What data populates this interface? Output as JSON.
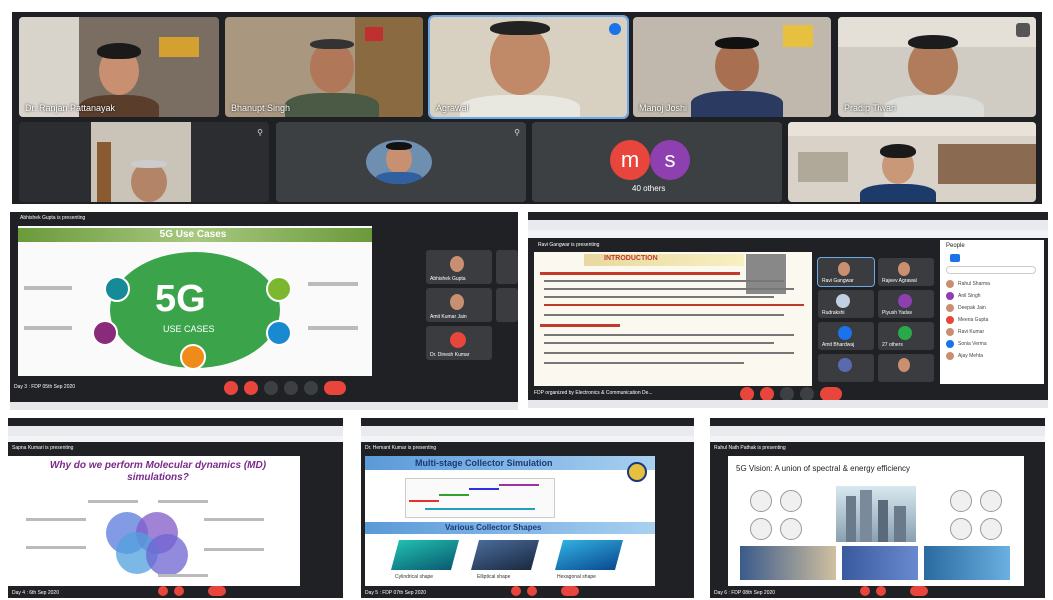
{
  "meeting": {
    "participants": [
      {
        "name": "Dr. Ranjan Pattanayak"
      },
      {
        "name": "Bhanupt Singh"
      },
      {
        "name": "Agrawal"
      },
      {
        "name": "Manoj Joshi"
      },
      {
        "name": "Pradip Tiwari"
      }
    ],
    "others_label": "40 others",
    "avatar_m": "m",
    "avatar_s": "s"
  },
  "ss1": {
    "presenting": "Abhishek Gupta is presenting",
    "slide_title": "5G Use Cases",
    "center_big": "5G",
    "center_small": "USE CASES",
    "side": [
      {
        "name": "Abhishek Gupta"
      },
      {
        "name": "Amit Kumar Jain"
      },
      {
        "name": "Dr. Dinesh Kumar"
      }
    ],
    "footer": "Day 3 : FDP 05th Sep 2020"
  },
  "ss2": {
    "presenting": "Ravi Gangwar is presenting",
    "slide_title": "INTRODUCTION",
    "people_title": "People",
    "side": [
      {
        "name": "Ravi Gangwar"
      },
      {
        "name": "Rajeev Agrawal"
      },
      {
        "name": "Rudrakshi"
      },
      {
        "name": "Piyush Yadav"
      },
      {
        "name": "Amit Bhardwaj"
      },
      {
        "name": "27 others"
      }
    ],
    "people": [
      "Rahul Sharma",
      "Anil Singh",
      "Deepak Jain",
      "Meena Gupta",
      "Ravi Kumar",
      "Sonia Verma",
      "Ajay Mehta"
    ],
    "footer": "FDP organized by Electronics & Communication De..."
  },
  "ss3": {
    "presenting": "Sapna Kumari is presenting",
    "slide_title": "Why do we perform Molecular dynamics (MD) simulations?",
    "footer": "Day 4 : 6th Sep 2020"
  },
  "ss4": {
    "presenting": "Dr. Hemant Kumar is presenting",
    "slide_title": "Multi-stage Collector Simulation",
    "sub_title": "Various Collector Shapes",
    "labels": [
      "Cylindrical shape",
      "Elliptical shape",
      "Hexagonal shape"
    ],
    "footer": "Day 5 : FDP 07th Sep 2020"
  },
  "ss5": {
    "presenting": "Rahul Nath Pathak is presenting",
    "slide_title": "5G Vision: A union of spectral & energy efficiency",
    "footer": "Day 6 : FDP 08th Sep 2020"
  },
  "colors": {
    "accent_red": "#e8453c",
    "meeting_bg": "#1f2023",
    "green_5g": "#3ba44a"
  }
}
